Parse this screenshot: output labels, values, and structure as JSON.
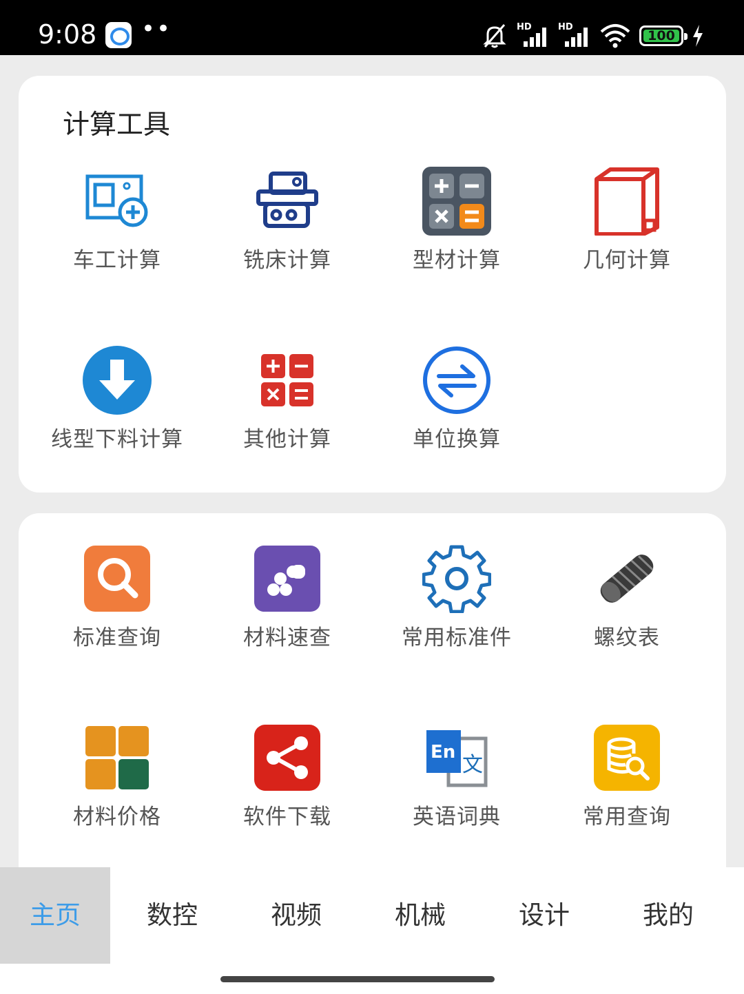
{
  "status_bar": {
    "time": "9:08",
    "dots": "••",
    "signal1_label": "HD",
    "signal2_label": "HD",
    "battery": "100"
  },
  "calc_tools": {
    "title": "计算工具",
    "items": [
      {
        "label": "车工计算",
        "icon": "lathe-calc-icon"
      },
      {
        "label": "铣床计算",
        "icon": "milling-machine-icon"
      },
      {
        "label": "型材计算",
        "icon": "calculator-icon"
      },
      {
        "label": "几何计算",
        "icon": "cube-icon"
      },
      {
        "label": "线型下料计算",
        "icon": "download-circle-icon"
      },
      {
        "label": "其他计算",
        "icon": "math-ops-icon"
      },
      {
        "label": "单位换算",
        "icon": "exchange-icon"
      }
    ]
  },
  "query_tools": {
    "items": [
      {
        "label": "标准查询",
        "icon": "search-icon"
      },
      {
        "label": "材料速查",
        "icon": "material-stack-icon"
      },
      {
        "label": "常用标准件",
        "icon": "gear-icon"
      },
      {
        "label": "螺纹表",
        "icon": "thread-rod-icon"
      },
      {
        "label": "材料价格",
        "icon": "price-grid-icon"
      },
      {
        "label": "软件下载",
        "icon": "share-icon"
      },
      {
        "label": "英语词典",
        "icon": "dictionary-icon"
      },
      {
        "label": "常用查询",
        "icon": "database-search-icon"
      }
    ]
  },
  "tabs": [
    "主页",
    "数控",
    "视频",
    "机械",
    "设计",
    "我的"
  ],
  "active_tab": "主页",
  "colors": {
    "accent": "#3d9ce8",
    "lathe_blue": "#1e88d4",
    "mill_navy": "#1f3d8a",
    "red": "#d8322a",
    "orange": "#f07c3c",
    "purple": "#6a4fb0",
    "yellow": "#f5b400"
  }
}
